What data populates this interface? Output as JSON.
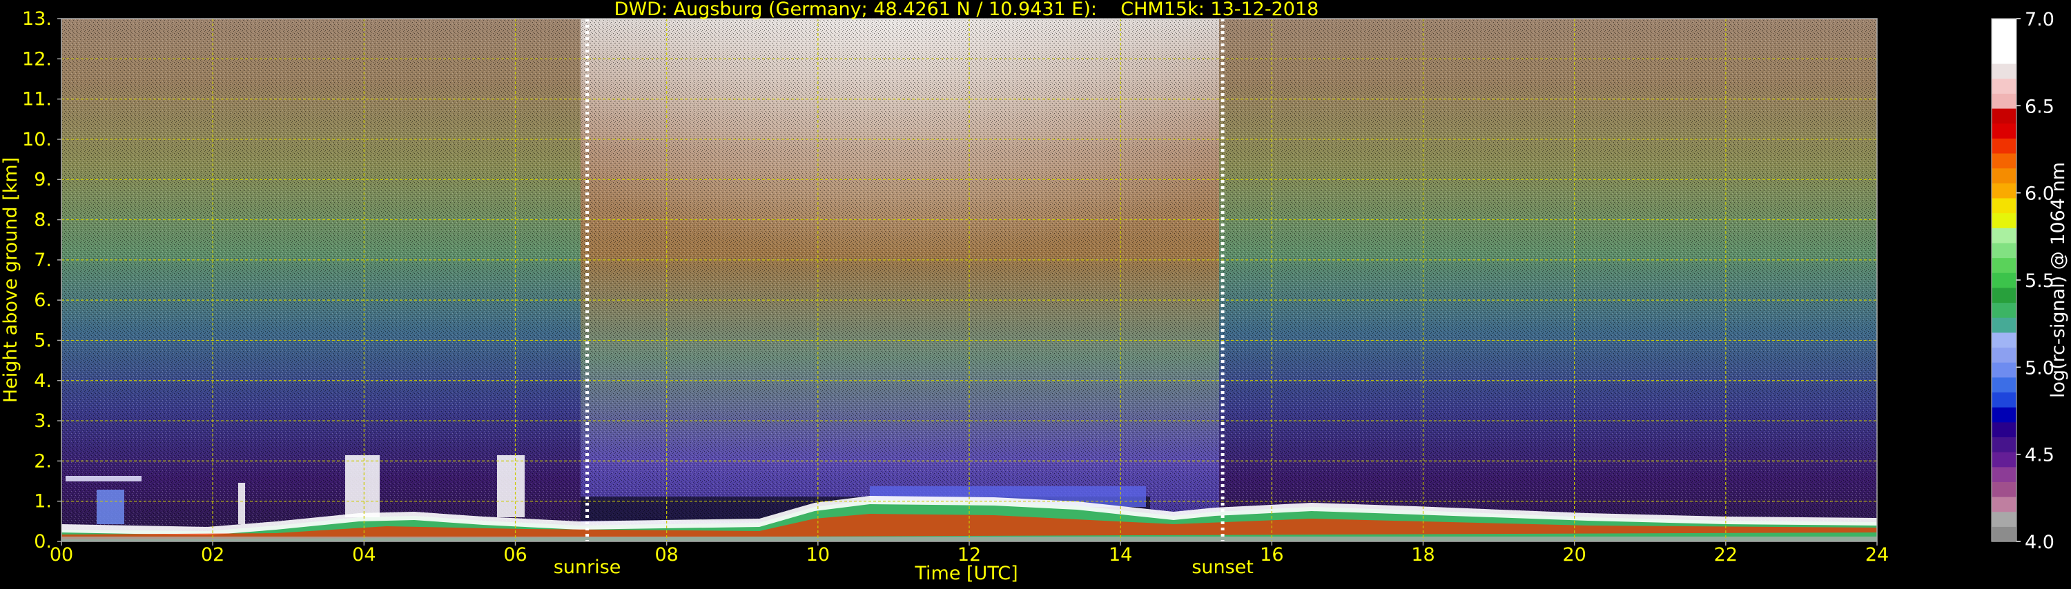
{
  "chart_data": {
    "type": "heatmap",
    "title": "DWD: Augsburg (Germany; 48.4261 N / 10.9431 E):    CHM15k: 13-12-2018",
    "xlabel": "Time [UTC]",
    "ylabel": "Height above ground [km]",
    "x_range": [
      0,
      24
    ],
    "y_range": [
      0,
      13
    ],
    "x_ticks": [
      "00",
      "02",
      "04",
      "06",
      "08",
      "10",
      "12",
      "14",
      "16",
      "18",
      "20",
      "22",
      "24"
    ],
    "y_ticks": [
      "0.",
      "1.",
      "2.",
      "3.",
      "4.",
      "5.",
      "6.",
      "7.",
      "8.",
      "9.",
      "10.",
      "11.",
      "12.",
      "13."
    ],
    "grid": true,
    "colorbar": {
      "label": "log(rc-signal) @ 1064 nm",
      "range": [
        4.0,
        7.0
      ],
      "ticks": [
        "4.0",
        "4.5",
        "5.0",
        "5.5",
        "6.0",
        "6.5",
        "7.0"
      ],
      "colors": [
        "#8c8c8c",
        "#a8a8a8",
        "#bf7fa0",
        "#a0508c",
        "#8c3c96",
        "#641e96",
        "#46148c",
        "#28008c",
        "#0000b4",
        "#1e46dc",
        "#3c6ee6",
        "#6e8cf0",
        "#8ca0f0",
        "#a0b4f5",
        "#46aa96",
        "#3cb464",
        "#28a03c",
        "#3cc34b",
        "#5ad25a",
        "#82e182",
        "#aaf0a0",
        "#e6f50a",
        "#f5e100",
        "#faaa00",
        "#f58c00",
        "#f56400",
        "#f03200",
        "#dc0000",
        "#c80000",
        "#f0b4b4",
        "#f5c8c8",
        "#ebe1e1",
        "#ffffff",
        "#ffffff",
        "#ffffff"
      ]
    },
    "markers": [
      {
        "label": "sunrise",
        "x": 6.95
      },
      {
        "label": "sunset",
        "x": 15.35
      }
    ],
    "color_text": "#ffff00",
    "color_grid": "#cccc00"
  }
}
